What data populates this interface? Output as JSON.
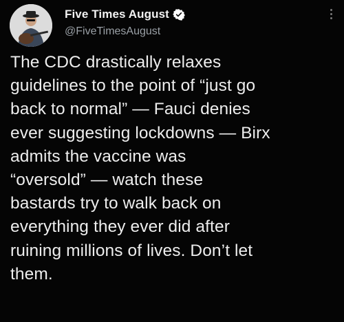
{
  "author": {
    "display_name": "Five Times August",
    "handle": "@FiveTimesAugust",
    "verified": true,
    "avatar_icon": "avatar-photo-guitar-player"
  },
  "tweet": {
    "text": "The CDC drastically relaxes\nguidelines to the point of “just go\nback to normal” — Fauci denies\never suggesting lockdowns — Birx\nadmits the vaccine was\n“oversold” — watch these\nbastards try to walk back on\neverything they ever did after\nruining millions of lives. Don’t let\nthem."
  },
  "colors": {
    "background": "#050505",
    "text": "#ededed",
    "handle": "#9aa0a6",
    "verified_badge": "#ffffff"
  },
  "icons": {
    "verified": "verified-badge-icon",
    "more": "more-options-icon"
  }
}
